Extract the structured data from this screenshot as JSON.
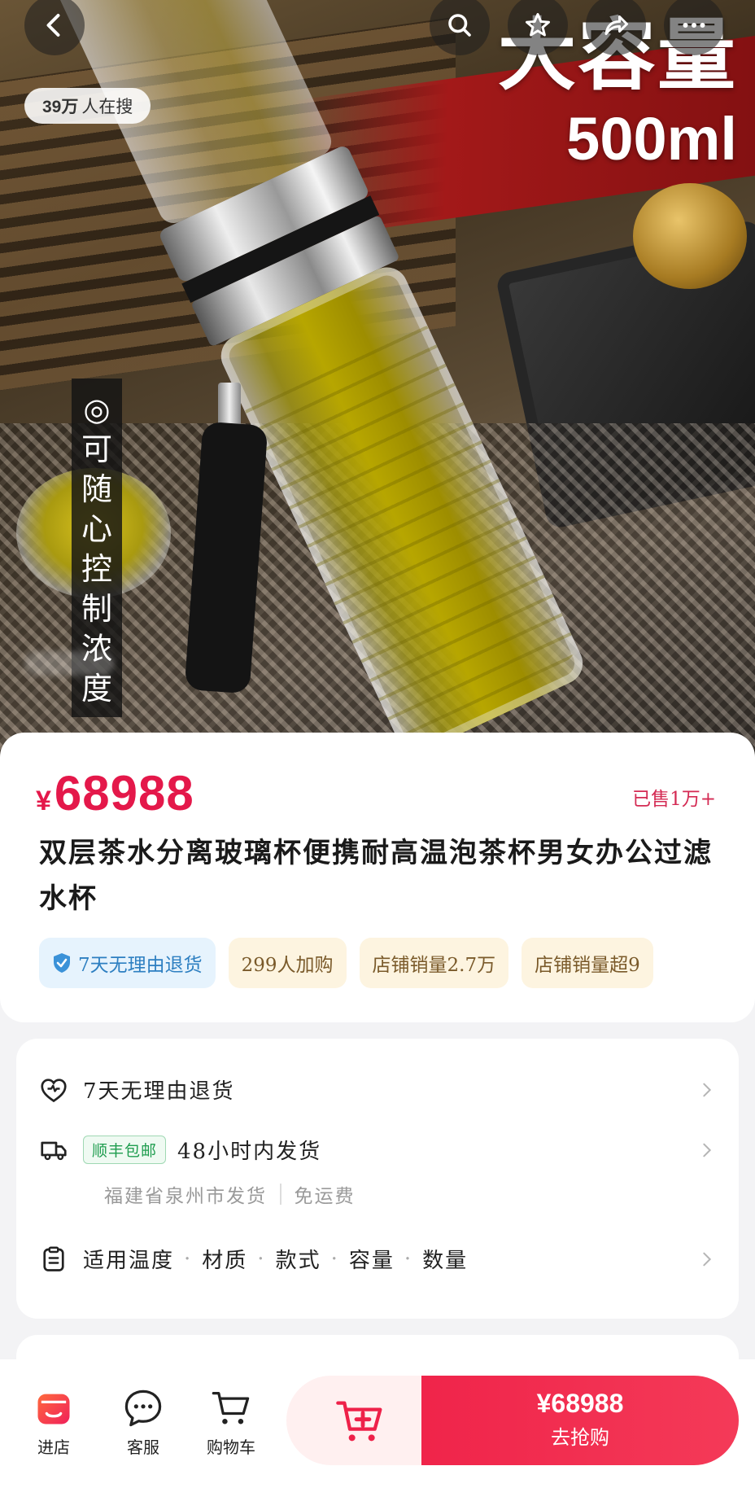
{
  "hero": {
    "headline": "大容量",
    "capacity": "500ml",
    "vertical_tagline": [
      "◎",
      "可",
      "随",
      "心",
      "控",
      "制",
      "浓",
      "度"
    ],
    "search_count": "39万",
    "search_suffix": "人在搜"
  },
  "top_nav": {
    "icons": [
      "back-icon",
      "search-icon",
      "favorite-star-icon",
      "share-icon",
      "more-icon"
    ]
  },
  "product": {
    "currency": "¥",
    "price": "68988",
    "sold": "已售1万+",
    "title": "双层茶水分离玻璃杯便携耐高温泡茶杯男女办公过滤水杯",
    "tags": [
      {
        "label": "7天无理由退货",
        "style": "blue"
      },
      {
        "label": "299人加购",
        "style": "cream"
      },
      {
        "label": "店铺销量2.7万",
        "style": "cream"
      },
      {
        "label": "店铺销量超9",
        "style": "cream"
      }
    ]
  },
  "services": {
    "return_label": "7天无理由退货",
    "shipping_badge": "顺丰包邮",
    "shipping_label": "48小时内发货",
    "ship_from": "福建省泉州市发货",
    "freight": "免运费",
    "specs": [
      "适用温度",
      "材质",
      "款式",
      "容量",
      "数量"
    ]
  },
  "bottom_bar": {
    "store_label": "进店",
    "service_label": "客服",
    "cart_label": "购物车",
    "buy_price": "¥68988",
    "buy_label": "去抢购"
  },
  "colors": {
    "accent": "#e4184a",
    "buy_gradient_start": "#f0244a",
    "tag_blue": "#2d7fc1",
    "tag_cream_bg": "#fdf4e0"
  }
}
